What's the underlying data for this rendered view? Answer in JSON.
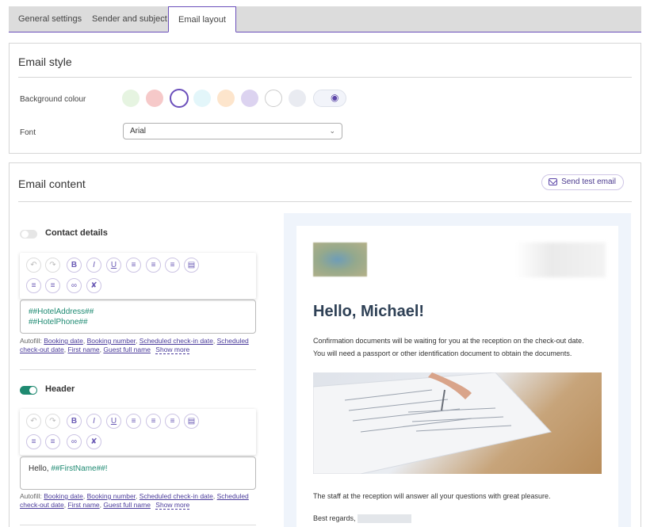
{
  "tabs": [
    {
      "label": "General settings"
    },
    {
      "label": "Sender and subject"
    },
    {
      "label": "Email layout"
    }
  ],
  "email_style": {
    "title": "Email style",
    "background_label": "Background colour",
    "swatches": [
      "#e6f4e1",
      "#f6c9c9",
      "#ffffff",
      "#e3f6fa",
      "#fde5cc",
      "#dcd3f0",
      "#ffffff",
      "#e9ebf1"
    ],
    "selected_swatch_index": 2,
    "font_label": "Font",
    "font_value": "Arial"
  },
  "email_content": {
    "title": "Email content",
    "send_test_label": "Send test email",
    "contact": {
      "title": "Contact details",
      "enabled": false,
      "line1": "##HotelAddress##",
      "line2": "##HotelPhone##"
    },
    "header": {
      "title": "Header",
      "enabled": true,
      "prefix": "Hello, ",
      "placeholder": "##FirstName##",
      "suffix": "!"
    },
    "autofill": {
      "label": "Autofill:",
      "items": [
        "Booking date",
        "Booking number",
        "Scheduled check-in date",
        "Scheduled check-out date",
        "First name",
        "Guest full name"
      ],
      "show_more": "Show more"
    }
  },
  "preview": {
    "greeting": "Hello, Michael!",
    "para1_line1": "Confirmation documents will be waiting for you at the reception on the check-out date.",
    "para1_line2": "You will need a passport or other identification document to obtain the documents.",
    "para2": "The staff at the reception will answer all your questions with great pleasure.",
    "regards": "Best regards,"
  },
  "colors": {
    "accent": "#6b4fbb",
    "teal": "#1e8a72"
  }
}
